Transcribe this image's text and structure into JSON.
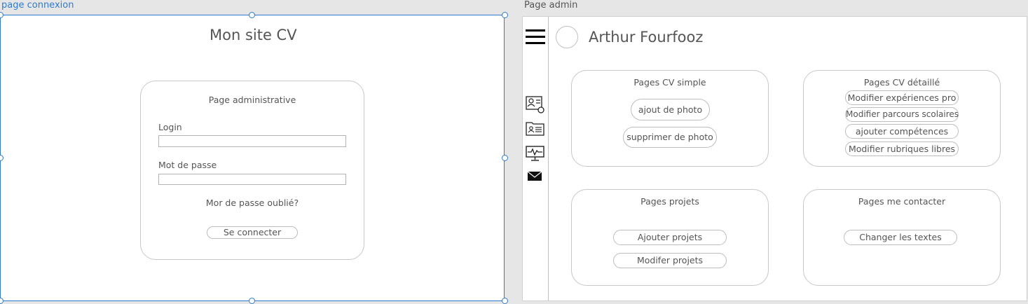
{
  "canvas": {
    "connexion_frame_label": "page connexion",
    "admin_frame_label": "Page admin"
  },
  "login_page": {
    "site_title": "Mon site CV",
    "card_title": "Page administrative",
    "login_label": "Login",
    "login_value": "",
    "password_label": "Mot de passe",
    "password_value": "",
    "forgot_password": "Mor de passe oublié?",
    "submit_label": "Se connecter"
  },
  "admin_page": {
    "user_name": "Arthur Fourfooz",
    "sidebar_icons": [
      "menu-icon",
      "profile-card-icon",
      "contact-folder-icon",
      "monitor-activity-icon",
      "mail-icon"
    ],
    "sections": {
      "cv_simple": {
        "title": "Pages CV simple",
        "actions": [
          "ajout de photo",
          "supprimer de photo"
        ]
      },
      "cv_detail": {
        "title": "Pages CV détaillé",
        "actions": [
          "Modifier expériences pro",
          "Modifier parcours scolaires",
          "ajouter compétences",
          "Modifier rubriques libres"
        ]
      },
      "projets": {
        "title": "Pages projets",
        "actions": [
          "Ajouter projets",
          "Modifer projets"
        ]
      },
      "contact": {
        "title": "Pages me contacter",
        "actions": [
          "Changer les textes"
        ]
      }
    }
  },
  "colors": {
    "canvas_background": "#e6e6e6",
    "selection_blue": "#2f7ad0",
    "frame_background": "#ffffff",
    "border_gray": "#c8c8c8",
    "text_gray": "#555555"
  }
}
